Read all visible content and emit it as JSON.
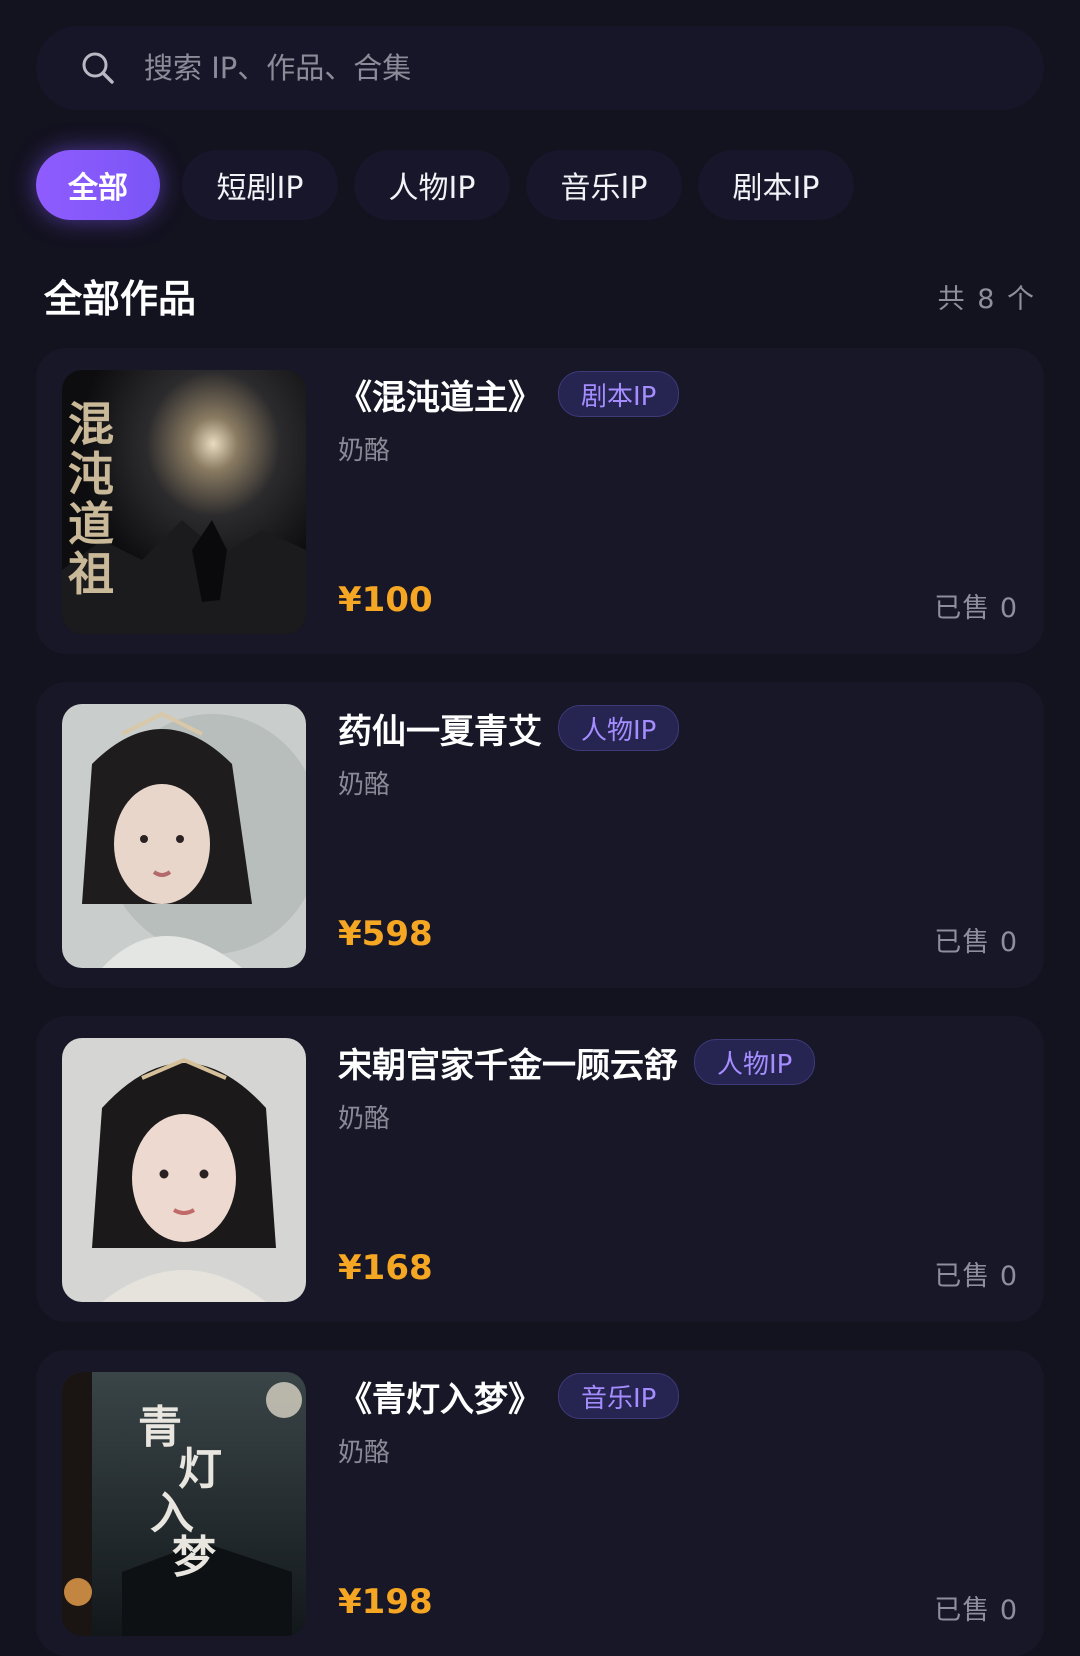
{
  "search": {
    "placeholder": "搜索 IP、作品、合集"
  },
  "tabs": [
    {
      "label": "全部",
      "active": true
    },
    {
      "label": "短剧IP"
    },
    {
      "label": "人物IP"
    },
    {
      "label": "音乐IP"
    },
    {
      "label": "剧本IP"
    }
  ],
  "section": {
    "title": "全部作品",
    "count": "共 8 个"
  },
  "items": [
    {
      "title": "《混沌道主》",
      "tag": "剧本IP",
      "author": "奶酪",
      "price": "¥100",
      "sold": "已售 0",
      "cover_text": "混沌道祖"
    },
    {
      "title": "药仙一夏青艾",
      "tag": "人物IP",
      "author": "奶酪",
      "price": "¥598",
      "sold": "已售 0"
    },
    {
      "title": "宋朝官家千金一顾云舒",
      "tag": "人物IP",
      "author": "奶酪",
      "price": "¥168",
      "sold": "已售 0"
    },
    {
      "title": "《青灯入梦》",
      "tag": "音乐IP",
      "author": "奶酪",
      "price": "¥198",
      "sold": "已售 0",
      "cover_text": "青灯入梦"
    }
  ],
  "colors": {
    "accent": "#8f5cff",
    "price": "#f5a623",
    "tag_text": "#a58dff",
    "background": "#13121f"
  }
}
